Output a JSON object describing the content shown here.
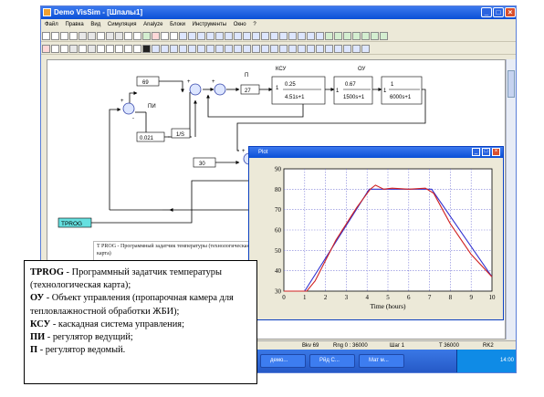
{
  "window": {
    "title": "Demo VisSim - [Шпалы1]",
    "buttons": {
      "minimize": "_",
      "maximize": "□",
      "close": "×"
    }
  },
  "menu": [
    "Файл",
    "Правка",
    "Вид",
    "Симуляция",
    "Analyze",
    "Блоки",
    "Инструменты",
    "Окно",
    "?"
  ],
  "diagram": {
    "blocks": {
      "const69": "69",
      "pi_label": "ПИ",
      "gain_pi": "0.021",
      "integrator": "1/S",
      "p_label": "П",
      "gain_p": "27",
      "ksu_label": "КСУ",
      "ksu_num": "0.25",
      "ksu_den": "4.51s+1",
      "ou_label": "ОУ",
      "ou1_num": "0.67",
      "ou1_den": "1500s+1",
      "ou2_num": "1",
      "ou2_den": "6000s+1",
      "const30": "30",
      "one": "1",
      "tprog": "TPROG",
      "sum_plus": "+",
      "sum_minus": "-"
    },
    "prog_note": "T PROG - Программный задатчик температуры (технологическая карта)"
  },
  "plot": {
    "title": "Plot",
    "buttons": {
      "minimize": "_",
      "maximize": "□",
      "close": "×"
    }
  },
  "chart_data": {
    "type": "line",
    "xlabel": "Time (hours)",
    "ylabel": "",
    "xlim": [
      0,
      10
    ],
    "ylim": [
      30,
      90
    ],
    "xticks": [
      0,
      1,
      2,
      3,
      4,
      5,
      6,
      7,
      8,
      9,
      10
    ],
    "yticks": [
      30,
      40,
      50,
      60,
      70,
      80,
      90
    ],
    "grid": true,
    "series": [
      {
        "color": "#3030d0",
        "x": [
          0,
          1,
          4.1,
          5,
          6,
          7.1,
          10
        ],
        "y": [
          30,
          30,
          80,
          80,
          80,
          80,
          37
        ]
      },
      {
        "color": "#d02020",
        "x": [
          0,
          1.1,
          1.5,
          2.5,
          3.5,
          4.15,
          4.4,
          4.8,
          5.2,
          6,
          6.8,
          7.2,
          8,
          9,
          10
        ],
        "y": [
          30,
          30,
          35,
          55,
          71,
          80,
          82,
          80,
          80.5,
          80,
          80.5,
          78,
          63,
          48,
          37
        ]
      }
    ]
  },
  "status": {
    "a": "Bkv 69",
    "b": "Rng 0 : 36000",
    "c": "Шаг 1",
    "d": "T 36000",
    "e": "RK2"
  },
  "taskbar": {
    "items": [
      "демо...",
      "Рйд С...",
      "Мат м..."
    ],
    "clock": "14:00"
  },
  "annotation": [
    {
      "term": "TPROG",
      "text": " - Программный задатчик температуры (технологическая карта);"
    },
    {
      "term": "ОУ",
      "text": " - Объект управления (пропарочная камера для тепловлажностной обработки ЖБИ);"
    },
    {
      "term": "КСУ",
      "text": " - каскадная система управления;"
    },
    {
      "term": "ПИ",
      "text": " - регулятор ведущий;"
    },
    {
      "term": "П",
      "text": " - регулятор ведомый."
    }
  ],
  "colors": {
    "title_bar": "#0a4fd6",
    "taskbar": "#2457c4",
    "tprog_block": "#66e0e0",
    "series_blue": "#3030d0",
    "series_red": "#d02020"
  }
}
